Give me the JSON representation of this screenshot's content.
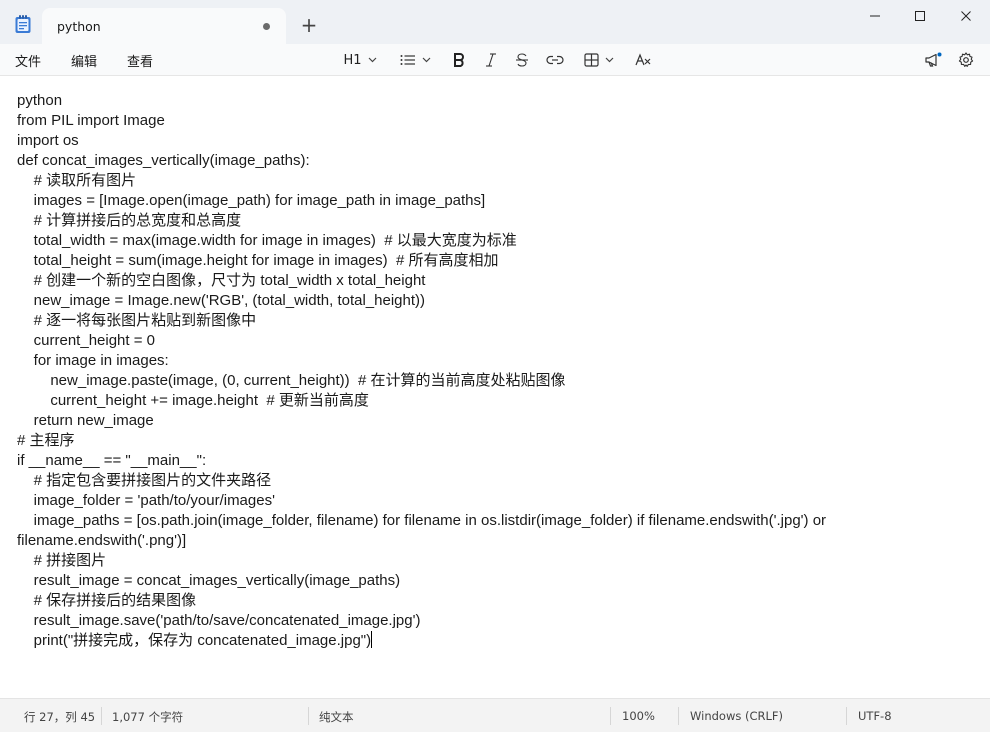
{
  "window": {
    "tab_title": "python",
    "new_tab_symbol": "+",
    "controls": [
      "minimize-icon",
      "maximize-icon",
      "close-icon"
    ]
  },
  "menu": {
    "file": "文件",
    "edit": "编辑",
    "view": "查看"
  },
  "toolbar": {
    "heading": "H1",
    "icons": [
      "list-icon",
      "bold-icon",
      "italic-icon",
      "strikethrough-icon",
      "link-icon",
      "table-icon",
      "clear-format-icon",
      "megaphone-icon",
      "gear-icon"
    ]
  },
  "editor": {
    "lines": [
      "python",
      "from PIL import Image",
      "import os",
      "def concat_images_vertically(image_paths):",
      "    # 读取所有图片",
      "    images = [Image.open(image_path) for image_path in image_paths]",
      "    # 计算拼接后的总宽度和总高度",
      "    total_width = max(image.width for image in images)  # 以最大宽度为标准",
      "    total_height = sum(image.height for image in images)  # 所有高度相加",
      "    # 创建一个新的空白图像，尺寸为 total_width x total_height",
      "    new_image = Image.new('RGB', (total_width, total_height))",
      "    # 逐一将每张图片粘贴到新图像中",
      "    current_height = 0",
      "    for image in images:",
      "        new_image.paste(image, (0, current_height))  # 在计算的当前高度处粘贴图像",
      "        current_height += image.height  # 更新当前高度",
      "    return new_image",
      "# 主程序",
      "if __name__ == \"__main__\":",
      "    # 指定包含要拼接图片的文件夹路径",
      "    image_folder = 'path/to/your/images'",
      "    image_paths = [os.path.join(image_folder, filename) for filename in os.listdir(image_folder) if filename.endswith('.jpg') or",
      "filename.endswith('.png')]",
      "    # 拼接图片",
      "    result_image = concat_images_vertically(image_paths)",
      "    # 保存拼接后的结果图像",
      "    result_image.save('path/to/save/concatenated_image.jpg')",
      "    print(\"拼接完成，保存为 concatenated_image.jpg\")"
    ]
  },
  "status": {
    "position": "行 27，列 45",
    "char_count": "1,077 个字符",
    "format": "纯文本",
    "zoom": "100%",
    "line_ending": "Windows (CRLF)",
    "encoding": "UTF-8"
  }
}
